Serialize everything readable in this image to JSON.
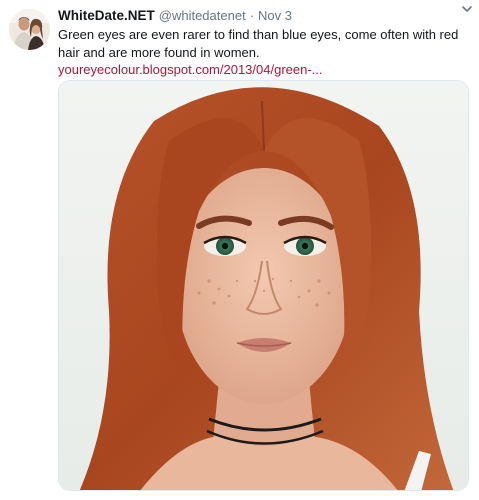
{
  "tweet": {
    "display_name": "WhiteDate.NET",
    "handle": "@whitedatenet",
    "separator": "·",
    "timestamp": "Nov 3",
    "text": "Green eyes are even rarer to find than blue eyes, come often with red hair and are more found in women.",
    "link": "youreyecolour.blogspot.com/2013/04/green-...",
    "caret_icon": "chevron-down-icon",
    "avatar_icon": "profile-photo",
    "media_subject": "photo"
  },
  "colors": {
    "name": "#14171a",
    "meta": "#657786",
    "link": "#b0153a",
    "background": "#ffffff"
  }
}
